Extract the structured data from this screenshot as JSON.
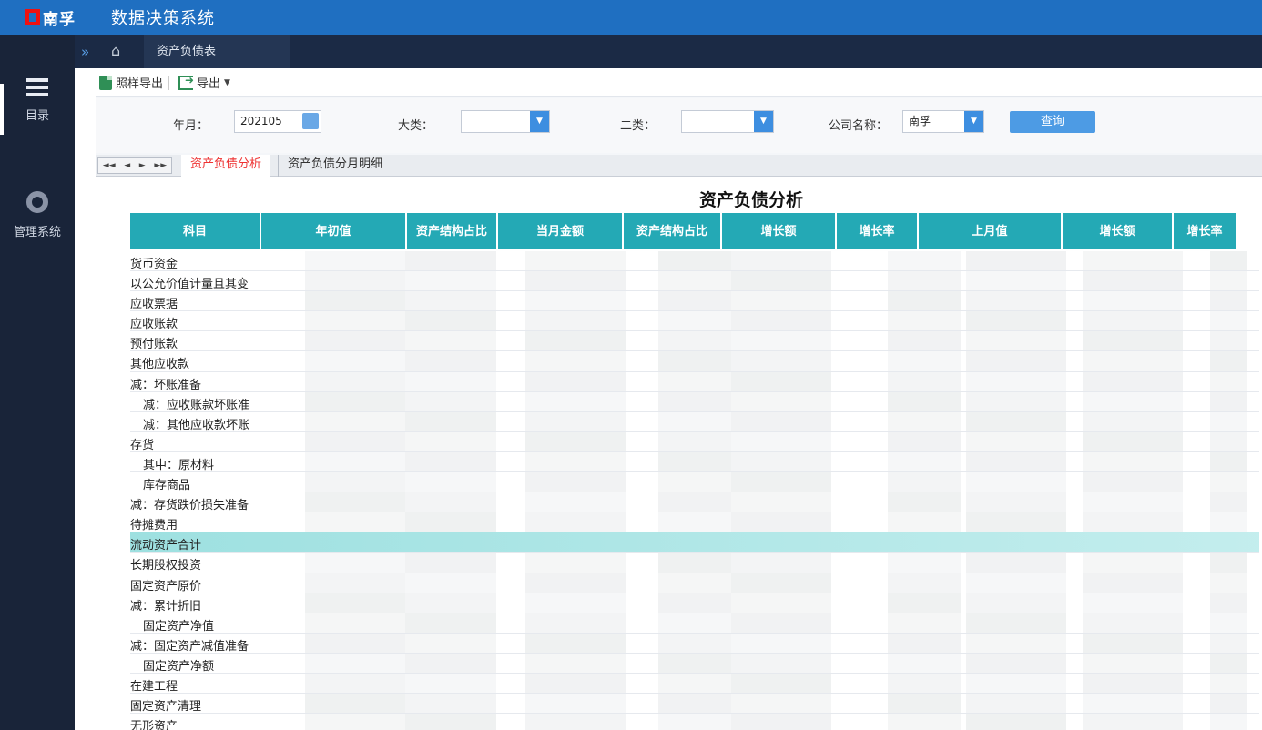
{
  "header": {
    "logo_text": "南孚",
    "app_title": "数据决策系统"
  },
  "sidebar": {
    "items": [
      {
        "label": "目录",
        "icon": "list-icon"
      },
      {
        "label": "管理系统",
        "icon": "gear-icon"
      }
    ]
  },
  "tabstrip": {
    "expand_icon": "»",
    "home_icon": "⌂",
    "active_tab": "资产负债表"
  },
  "toolbar": {
    "excel_export_label": "照样导出",
    "export_label": "导出"
  },
  "filters": {
    "year_month_label": "年月：",
    "year_month_value": "202105",
    "category_label": "大类：",
    "category_value": "",
    "subcategory_label": "二类：",
    "subcategory_value": "",
    "company_label": "公司名称：",
    "company_value": "南孚",
    "query_label": "查询"
  },
  "sheet_tabs": {
    "nav": [
      "◄◄",
      "◄",
      "►",
      "►►"
    ],
    "active": "资产负债分析",
    "inactive": "资产负债分月明细"
  },
  "report": {
    "title": "资产负债分析",
    "columns": [
      "科目",
      "年初值",
      "资产结构占比",
      "当月金额",
      "资产结构占比",
      "增长额",
      "增长率",
      "上月值",
      "增长额",
      "增长率"
    ],
    "rows": [
      {
        "label": "货币资金",
        "indent": false
      },
      {
        "label": "以公允价值计量且其变",
        "indent": false
      },
      {
        "label": "应收票据",
        "indent": false
      },
      {
        "label": "应收账款",
        "indent": false
      },
      {
        "label": "预付账款",
        "indent": false
      },
      {
        "label": "其他应收款",
        "indent": false
      },
      {
        "label": "减：坏账准备",
        "indent": false
      },
      {
        "label": "减：应收账款坏账准",
        "indent": true
      },
      {
        "label": "减：其他应收款坏账",
        "indent": true
      },
      {
        "label": "存货",
        "indent": false
      },
      {
        "label": "其中：原材料",
        "indent": true
      },
      {
        "label": "库存商品",
        "indent": true
      },
      {
        "label": "减：存货跌价损失准备",
        "indent": false
      },
      {
        "label": "待摊费用",
        "indent": false
      },
      {
        "label": "流动资产合计",
        "indent": false,
        "highlight": true
      },
      {
        "label": "长期股权投资",
        "indent": false
      },
      {
        "label": "固定资产原价",
        "indent": false
      },
      {
        "label": "减：累计折旧",
        "indent": false
      },
      {
        "label": "固定资产净值",
        "indent": true
      },
      {
        "label": "减：固定资产减值准备",
        "indent": false
      },
      {
        "label": "固定资产净额",
        "indent": true
      },
      {
        "label": "在建工程",
        "indent": false
      },
      {
        "label": "固定资产清理",
        "indent": false
      },
      {
        "label": "无形资产",
        "indent": false
      }
    ]
  }
}
